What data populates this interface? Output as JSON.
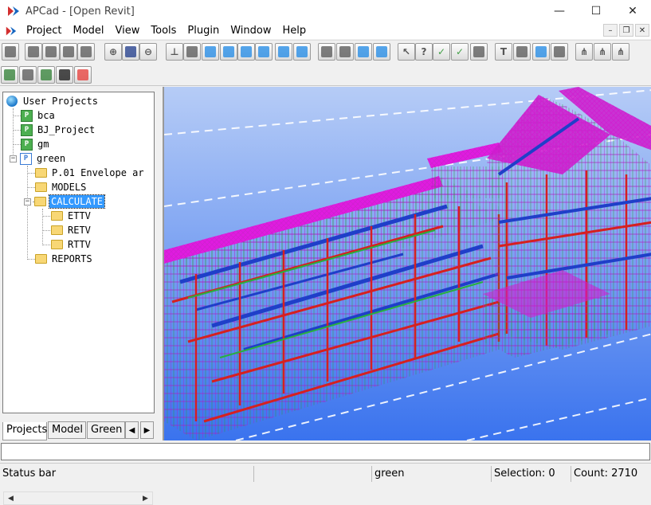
{
  "window": {
    "title": "APCad - [Open Revit]",
    "minimize": "—",
    "maximize": "☐",
    "close": "✕"
  },
  "menu": [
    "Project",
    "Model",
    "View",
    "Tools",
    "Plugin",
    "Window",
    "Help"
  ],
  "mdi": {
    "minimize": "–",
    "restore": "❐",
    "close": "✕"
  },
  "toolbar": {
    "row1": [
      "new-icon",
      "open-icon",
      "table-icon",
      "window-icon",
      "list-icon",
      "zoom-in-icon",
      "save-icon",
      "zoom-out-icon",
      "axis-icon",
      "box-icon",
      "view-top-icon",
      "view-rotate-icon",
      "view-side-icon",
      "view-front-icon",
      "view-right-icon",
      "view-down-icon",
      "print-icon",
      "slope-icon",
      "beam-icon",
      "column-icon",
      "select-icon",
      "query-icon",
      "check-icon",
      "check-all-icon",
      "erase-icon",
      "text-icon",
      "copy-icon",
      "snap-icon",
      "edit-icon",
      "tree-icon",
      "tree-edit-icon",
      "tree-add-icon"
    ],
    "row2": [
      "import-icon",
      "export-icon",
      "project-icon",
      "lock-icon",
      "delete-icon"
    ]
  },
  "tree": {
    "root": "User Projects",
    "projects": [
      {
        "label": "bca"
      },
      {
        "label": "BJ_Project"
      },
      {
        "label": "gm"
      },
      {
        "label": "green"
      }
    ],
    "green_children": [
      "P.01 Envelope ar",
      "MODELS",
      "CALCULATE",
      "REPORTS"
    ],
    "calculate_children": [
      "ETTV",
      "RETV",
      "RTTV"
    ],
    "selected": "CALCULATE"
  },
  "tabs": [
    "Projects",
    "Model",
    "Green I"
  ],
  "status": {
    "message": "Status bar",
    "project": "green",
    "selection": "Selection: 0",
    "count": "Count: 2710"
  },
  "colors": {
    "viewport_top": "#a7c2f5",
    "viewport_bottom": "#3f78ee",
    "roof": "#e01be0",
    "frame_red": "#d62020",
    "frame_blue": "#1f3fc9"
  }
}
